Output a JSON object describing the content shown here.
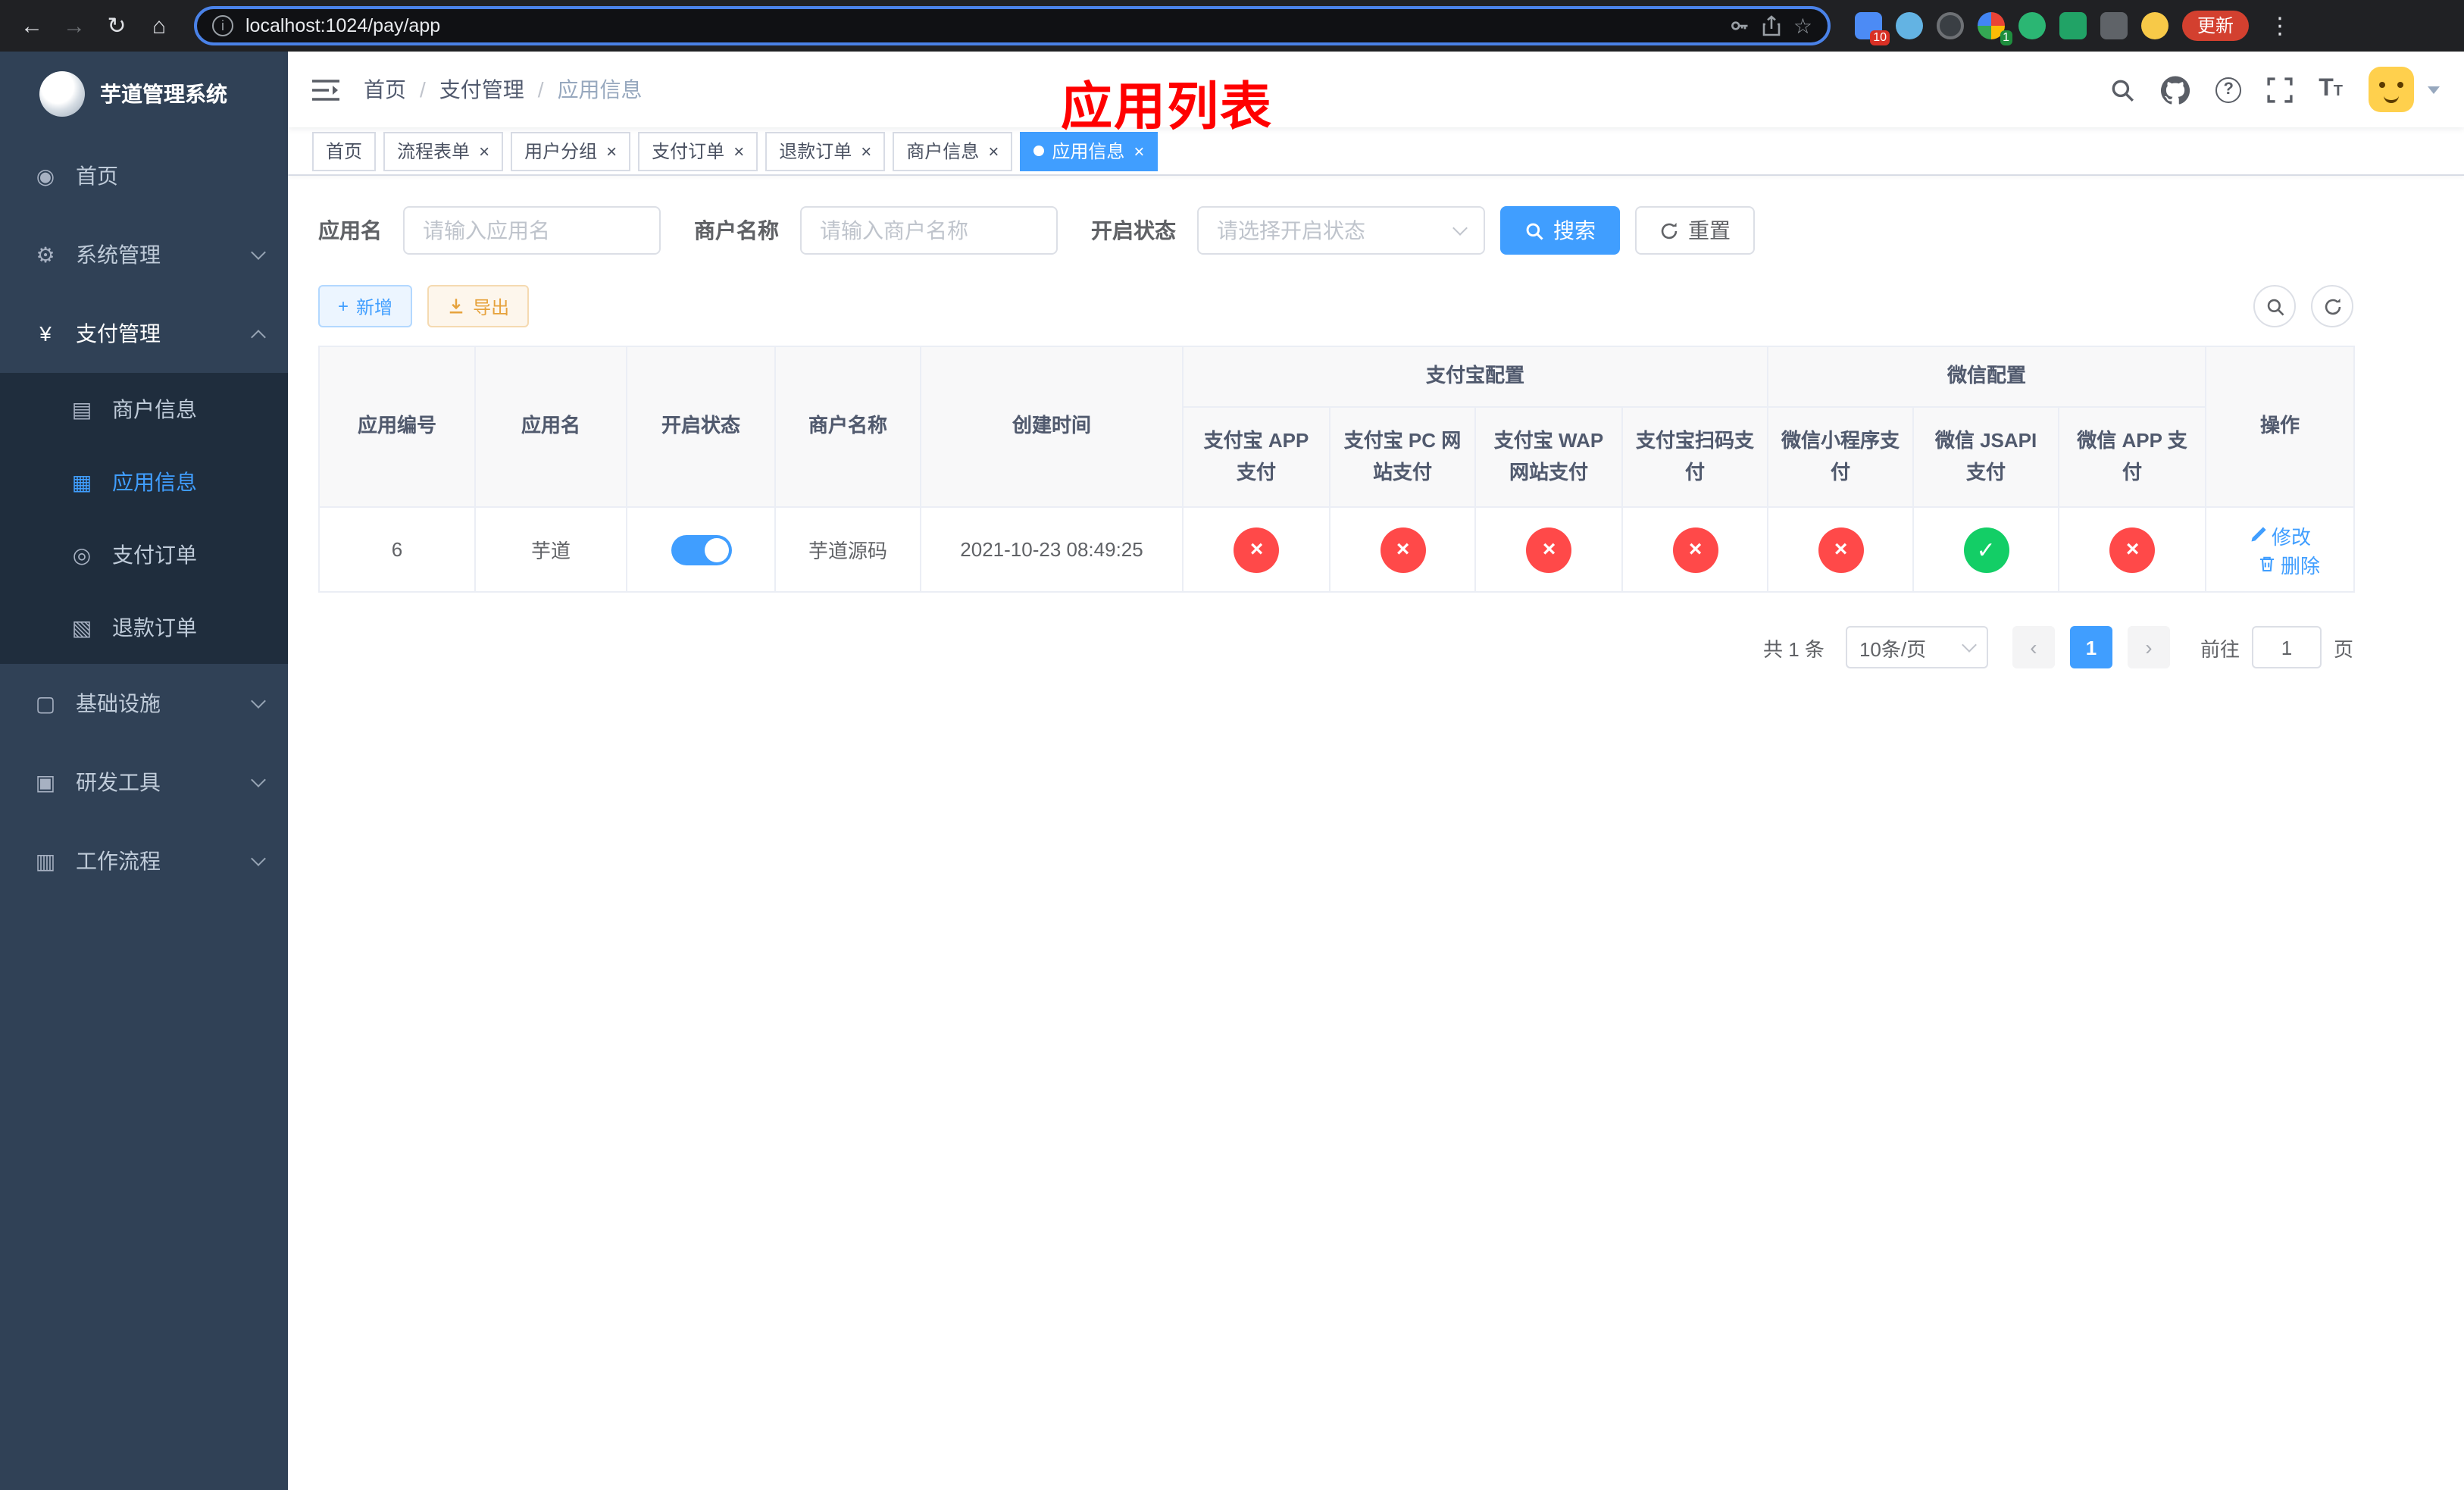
{
  "browser": {
    "url": "localhost:1024/pay/app",
    "update_button": "更新",
    "extension_badges": {
      "first": "10",
      "fourth": "1"
    }
  },
  "overlay_title": "应用列表",
  "sidebar": {
    "logo_title": "芋道管理系统",
    "menu": [
      {
        "label": "首页",
        "glyph": "◉"
      },
      {
        "label": "系统管理",
        "glyph": "⚙"
      },
      {
        "label": "支付管理",
        "glyph": "¥"
      },
      {
        "label": "基础设施",
        "glyph": "▢"
      },
      {
        "label": "研发工具",
        "glyph": "▣"
      },
      {
        "label": "工作流程",
        "glyph": "▥"
      }
    ],
    "pay_submenu": [
      {
        "label": "商户信息",
        "glyph": "▤"
      },
      {
        "label": "应用信息",
        "glyph": "▦"
      },
      {
        "label": "支付订单",
        "glyph": "◎"
      },
      {
        "label": "退款订单",
        "glyph": "▧"
      }
    ]
  },
  "breadcrumb": {
    "items": [
      "首页",
      "支付管理",
      "应用信息"
    ]
  },
  "tabs": [
    {
      "label": "首页"
    },
    {
      "label": "流程表单"
    },
    {
      "label": "用户分组"
    },
    {
      "label": "支付订单"
    },
    {
      "label": "退款订单"
    },
    {
      "label": "商户信息"
    },
    {
      "label": "应用信息"
    }
  ],
  "filters": {
    "app_name_label": "应用名",
    "app_name_placeholder": "请输入应用名",
    "merchant_label": "商户名称",
    "merchant_placeholder": "请输入商户名称",
    "status_label": "开启状态",
    "status_placeholder": "请选择开启状态",
    "search_button": "搜索",
    "reset_button": "重置"
  },
  "toolbar": {
    "add_button": "新增",
    "export_button": "导出"
  },
  "table": {
    "columns": {
      "app_id": "应用编号",
      "app_name": "应用名",
      "status": "开启状态",
      "merchant_name": "商户名称",
      "create_time": "创建时间",
      "alipay_group": "支付宝配置",
      "wechat_group": "微信配置",
      "alipay_app": "支付宝 APP 支付",
      "alipay_pc": "支付宝 PC 网站支付",
      "alipay_wap": "支付宝 WAP 网站支付",
      "alipay_qr": "支付宝扫码支付",
      "wechat_lite": "微信小程序支付",
      "wechat_jsapi": "微信 JSAPI 支付",
      "wechat_app": "微信 APP 支付",
      "actions": "操作"
    },
    "rows": [
      {
        "app_id": "6",
        "app_name": "芋道",
        "status": "on",
        "merchant_name": "芋道源码",
        "create_time": "2021-10-23 08:49:25",
        "alipay_app": "closed",
        "alipay_pc": "closed",
        "alipay_wap": "closed",
        "alipay_qr": "closed",
        "wechat_lite": "closed",
        "wechat_jsapi": "enabled",
        "wechat_app": "closed",
        "edit_label": "修改",
        "delete_label": "删除"
      }
    ]
  },
  "pagination": {
    "total_text": "共 1 条",
    "page_size_text": "10条/页",
    "current_page": "1",
    "goto_label": "前往",
    "goto_value": "1",
    "page_unit": "页"
  },
  "icons": {
    "back": "←",
    "forward": "→",
    "reload": "↻",
    "home": "⌂",
    "info_letter": "i",
    "star": "☆",
    "kebab": "⋮",
    "help": "?",
    "font_size": "T",
    "plus": "+",
    "close": "×",
    "prev": "‹",
    "next": "›",
    "check": "✓",
    "cross": "×"
  },
  "colors": {
    "primary": "#409eff",
    "success": "#13ce66",
    "danger": "#ff4949",
    "warning": "#e6a23c",
    "sidebar_bg": "#304156",
    "sidebar_sub_bg": "#1f2d3d",
    "annotation_red": "#ff0000"
  }
}
